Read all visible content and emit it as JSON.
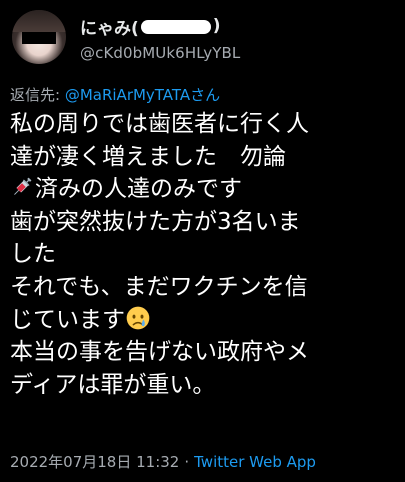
{
  "author": {
    "display_name": "にゃみ(",
    "display_name_end": ")",
    "handle": "@cKd0bMUk6HLyYBL"
  },
  "reply": {
    "prefix": "返信先: ",
    "target": "@MaRiArMyTATAさん"
  },
  "body": {
    "line1": "私の周りでは歯医者に行く人",
    "line2": "達が凄く増えました　勿論",
    "line3_text": "済みの人達のみです",
    "line4": "歯が突然抜けた方が3名いま",
    "line5": "した",
    "line6": "それでも、まだワクチンを信",
    "line7_text": "じています",
    "line8": "本当の事を告げない政府やメ",
    "line9": "ディアは罪が重い。",
    "line3_emoji": "syringe-emoji",
    "line7_emoji": "crying-face-emoji"
  },
  "meta": {
    "timestamp": "2022年07月18日 11:32",
    "separator": "·",
    "source": "Twitter Web App"
  },
  "colors": {
    "background": "#000000",
    "text_primary": "#e7e9ea",
    "text_secondary": "#a6abb1",
    "link": "#1d9bf0"
  }
}
